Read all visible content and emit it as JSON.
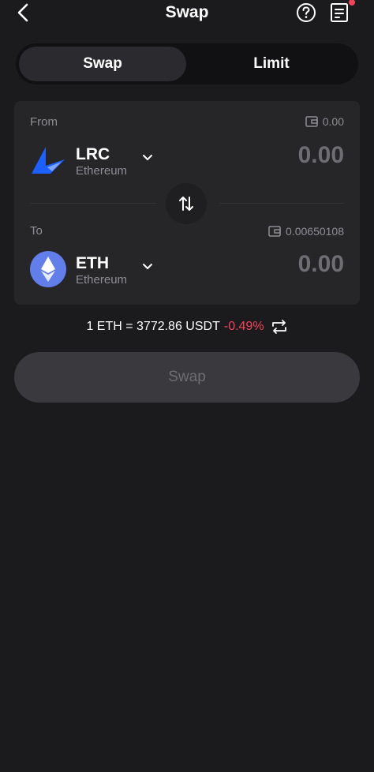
{
  "header": {
    "title": "Swap"
  },
  "tabs": [
    {
      "label": "Swap",
      "active": true
    },
    {
      "label": "Limit",
      "active": false
    }
  ],
  "from": {
    "label": "From",
    "balance": "0.00",
    "token_symbol": "LRC",
    "token_network": "Ethereum",
    "amount": "0.00"
  },
  "to": {
    "label": "To",
    "balance": "0.00650108",
    "token_symbol": "ETH",
    "token_network": "Ethereum",
    "amount": "0.00"
  },
  "rate": {
    "text": "1 ETH = 3772.86 USDT",
    "change": "-0.49%",
    "change_color": "#f0445b"
  },
  "action": {
    "label": "Swap"
  },
  "colors": {
    "background": "#1b1b1e",
    "card": "#262629",
    "muted_text": "#8e8e93",
    "notification_dot": "#f0445b",
    "lrc_blue": "#1c60ff",
    "eth_purple": "#627eea"
  },
  "icons": {
    "back": "chevron-left-icon",
    "help": "question-circle-icon",
    "orders": "document-list-icon",
    "wallet": "wallet-icon",
    "token_select": "chevron-down-icon",
    "swap_direction": "swap-vertical-arrows-icon",
    "rate_swap": "repeat-arrows-icon"
  }
}
